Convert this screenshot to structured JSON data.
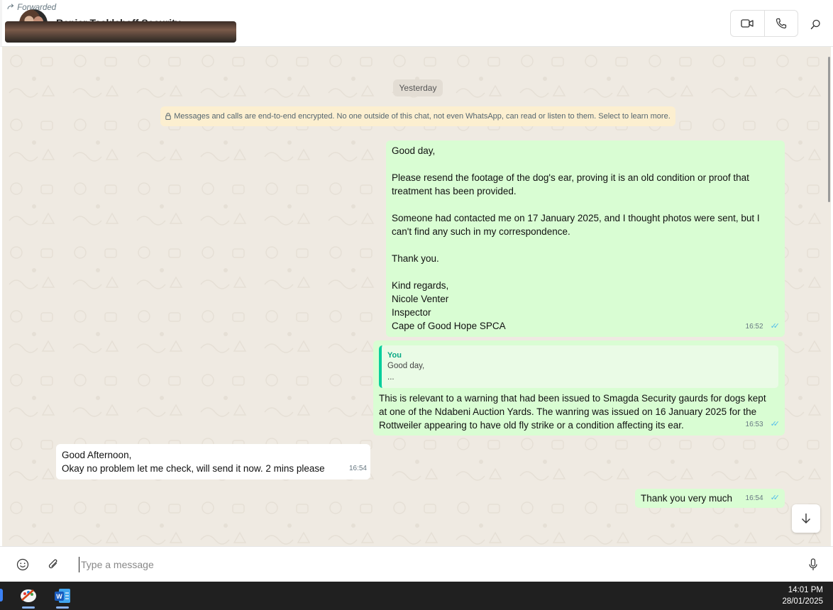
{
  "header": {
    "contact_name": "Renier Tacklehoff Security",
    "icons": [
      "video-call-icon",
      "voice-call-icon",
      "search-icon"
    ]
  },
  "chat": {
    "date_chip": "Yesterday",
    "encryption_notice": "Messages and calls are end-to-end encrypted. No one outside of this chat, not even WhatsApp, can read or listen to them. Select to learn more.",
    "messages": [
      {
        "direction": "outgoing",
        "lines": [
          "Good day,",
          "",
          "Please resend the footage of the dog's ear, proving it is an old condition or proof that treatment has been provided.",
          "",
          "Someone had contacted me on 17 January 2025, and I thought photos were sent, but I can't find any such in my correspondence.",
          "",
          "Thank you.",
          "",
          "Kind regards,",
          "Nicole Venter",
          "Inspector",
          "Cape of Good Hope SPCA"
        ],
        "time": "16:52",
        "read": true
      },
      {
        "direction": "outgoing",
        "quote": {
          "author": "You",
          "line1": "Good day,",
          "line2": "..."
        },
        "text": "This is relevant to a warning that had been issued to Smagda Security gaurds for dogs kept at one of the Ndabeni Auction Yards. The wanring was issued on 16 January 2025 for the Rottweiler appearing to have old fly strike or a condition affecting its ear.",
        "time": "16:53",
        "read": true
      },
      {
        "direction": "incoming",
        "line1": "Good Afternoon,",
        "line2": "Okay no problem let me check, will send it now. 2 mins please",
        "time": "16:54"
      },
      {
        "direction": "outgoing",
        "text": "Thank you very much",
        "time": "16:54",
        "read": true
      },
      {
        "direction": "incoming",
        "forwarded_label": "Forwarded",
        "has_image": true
      }
    ]
  },
  "composer": {
    "placeholder": "Type a message",
    "value": ""
  },
  "taskbar": {
    "time": "14:01 PM",
    "date": "28/01/2025",
    "apps": [
      "paint-app-icon",
      "word-app-icon"
    ]
  },
  "colors": {
    "outgoing_bubble": "#d9fdd3",
    "incoming_bubble": "#ffffff",
    "chat_background": "#efeae2",
    "read_ticks": "#53bdeb",
    "quote_accent": "#06cf9c"
  }
}
